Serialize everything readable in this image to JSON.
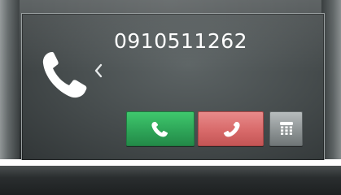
{
  "call": {
    "phone_number": "0910511262"
  },
  "icons": {
    "caller": "phone-handset-icon",
    "back": "chevron-left-icon",
    "answer": "phone-answer-icon",
    "reject": "phone-hangup-icon",
    "keypad": "keypad-phone-icon"
  },
  "colors": {
    "answer": "#2ea558",
    "reject": "#d86a6a",
    "keypad": "#8e9495",
    "text": "#ffffff"
  }
}
